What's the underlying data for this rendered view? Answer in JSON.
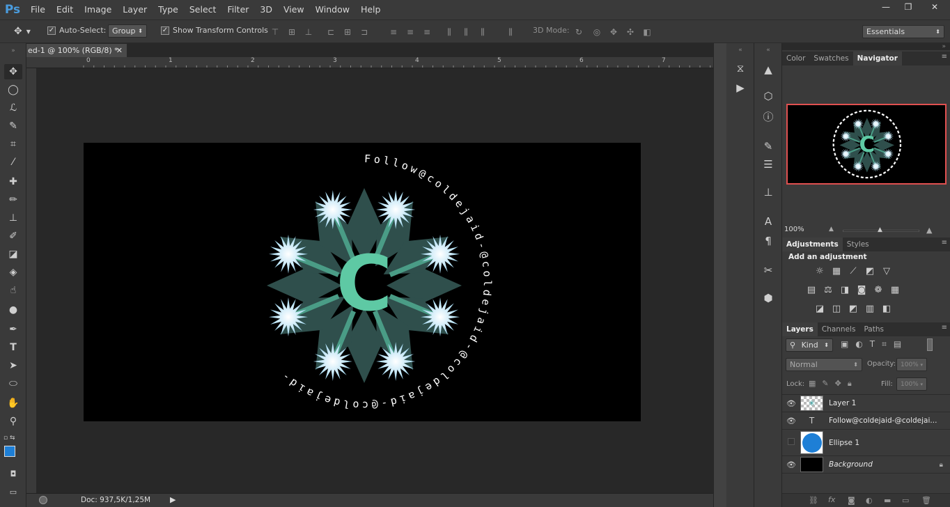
{
  "app": {
    "logo": "Ps"
  },
  "menu": [
    "File",
    "Edit",
    "Image",
    "Layer",
    "Type",
    "Select",
    "Filter",
    "3D",
    "View",
    "Window",
    "Help"
  ],
  "window_controls": {
    "minimize": "—",
    "restore": "❐",
    "close": "✕"
  },
  "options": {
    "auto_select_label": "Auto-Select:",
    "auto_select_value": "Group",
    "show_transform_label": "Show Transform Controls",
    "mode_3d_label": "3D Mode:",
    "workspace": "Essentials"
  },
  "document": {
    "tab_title": "ed-1 @ 100% (RGB/8) *",
    "close": "✕"
  },
  "ruler_numbers": [
    "0",
    "1",
    "2",
    "3",
    "4",
    "5",
    "6",
    "7"
  ],
  "artwork": {
    "center_letter": "C",
    "ring_text": "Follow@coldejaid-@coldejaid-@coldejaid-@coldejaid-",
    "colors": {
      "petal": "#2f4f4c",
      "flower": "#bfe8ff",
      "letter": "#5ec9a4",
      "ring_text": "#ffffff"
    }
  },
  "status": {
    "doc_size": "Doc: 937,5K/1,25M"
  },
  "navigator": {
    "tabs": [
      "Color",
      "Swatches",
      "Navigator"
    ],
    "active": "Navigator",
    "zoom": "100%"
  },
  "adjustments": {
    "tabs": [
      "Adjustments",
      "Styles"
    ],
    "heading": "Add an adjustment"
  },
  "layers_panel": {
    "tabs": [
      "Layers",
      "Channels",
      "Paths"
    ],
    "filter": "Kind",
    "blend_mode": "Normal",
    "opacity_label": "Opacity:",
    "opacity_value": "100%",
    "lock_label": "Lock:",
    "fill_label": "Fill:",
    "fill_value": "100%",
    "layers": [
      {
        "name": "Layer 1",
        "visible": true
      },
      {
        "name": "Follow@coldejaid-@coldejai...",
        "visible": true
      },
      {
        "name": "Ellipse 1",
        "visible": false
      },
      {
        "name": "Background",
        "visible": true
      }
    ]
  }
}
